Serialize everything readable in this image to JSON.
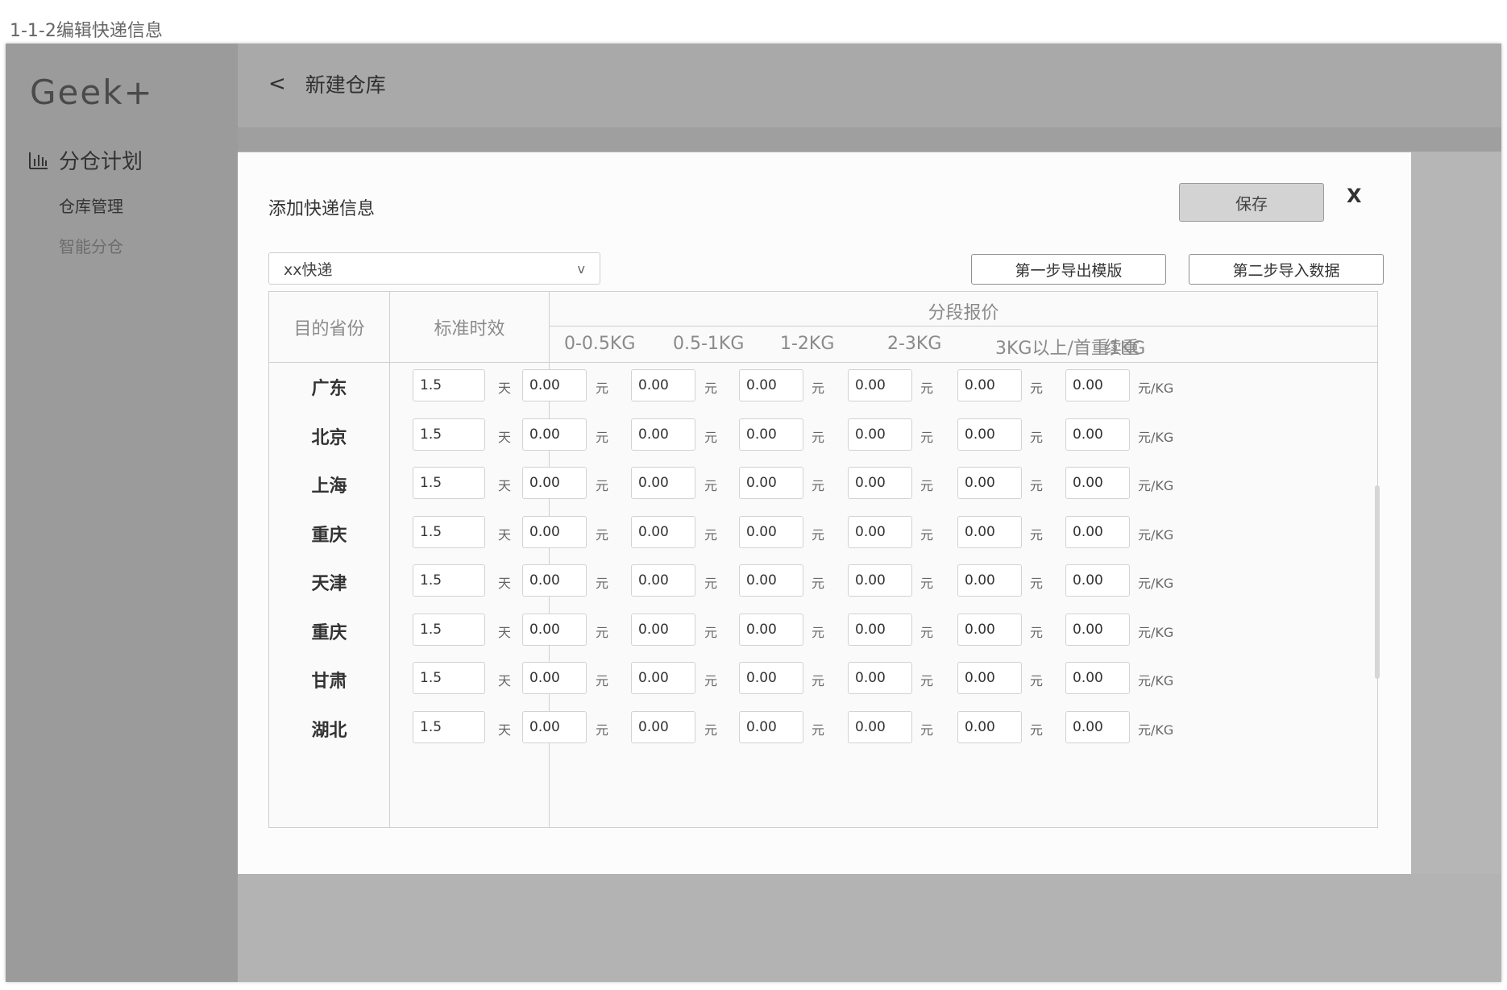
{
  "page_label": "1-1-2编辑快递信息",
  "sidebar": {
    "logo": "Geek+",
    "group_icon": "bar-chart-icon",
    "group_label": "分仓计划",
    "items": [
      {
        "label": "仓库管理"
      },
      {
        "label": "智能分仓"
      }
    ]
  },
  "header": {
    "back_label": "<",
    "title": "新建仓库"
  },
  "modal": {
    "title": "添加快递信息",
    "save_label": "保存",
    "close_label": "X",
    "select_value": "xx快递",
    "select_arrow": "v",
    "step1_label": "第一步导出模版",
    "step2_label": "第二步导入数据"
  },
  "table": {
    "headers": {
      "province": "目的省份",
      "standard": "标准时效",
      "segment": "分段报价"
    },
    "tiers": [
      "0-0.5KG",
      "0.5-1KG",
      "1-2KG",
      "2-3KG",
      "3KG以上/首重1KG",
      "续重"
    ],
    "day_unit": "天",
    "price_unit": "元",
    "per_kg_unit": "元/KG",
    "rows": [
      {
        "province": "广东",
        "days": "1.5",
        "prices": [
          "0.00",
          "0.00",
          "0.00",
          "0.00",
          "0.00",
          "0.00"
        ]
      },
      {
        "province": "北京",
        "days": "1.5",
        "prices": [
          "0.00",
          "0.00",
          "0.00",
          "0.00",
          "0.00",
          "0.00"
        ]
      },
      {
        "province": "上海",
        "days": "1.5",
        "prices": [
          "0.00",
          "0.00",
          "0.00",
          "0.00",
          "0.00",
          "0.00"
        ]
      },
      {
        "province": "重庆",
        "days": "1.5",
        "prices": [
          "0.00",
          "0.00",
          "0.00",
          "0.00",
          "0.00",
          "0.00"
        ]
      },
      {
        "province": "天津",
        "days": "1.5",
        "prices": [
          "0.00",
          "0.00",
          "0.00",
          "0.00",
          "0.00",
          "0.00"
        ]
      },
      {
        "province": "重庆",
        "days": "1.5",
        "prices": [
          "0.00",
          "0.00",
          "0.00",
          "0.00",
          "0.00",
          "0.00"
        ]
      },
      {
        "province": "甘肃",
        "days": "1.5",
        "prices": [
          "0.00",
          "0.00",
          "0.00",
          "0.00",
          "0.00",
          "0.00"
        ]
      },
      {
        "province": "湖北",
        "days": "1.5",
        "prices": [
          "0.00",
          "0.00",
          "0.00",
          "0.00",
          "0.00",
          "0.00"
        ]
      }
    ]
  }
}
